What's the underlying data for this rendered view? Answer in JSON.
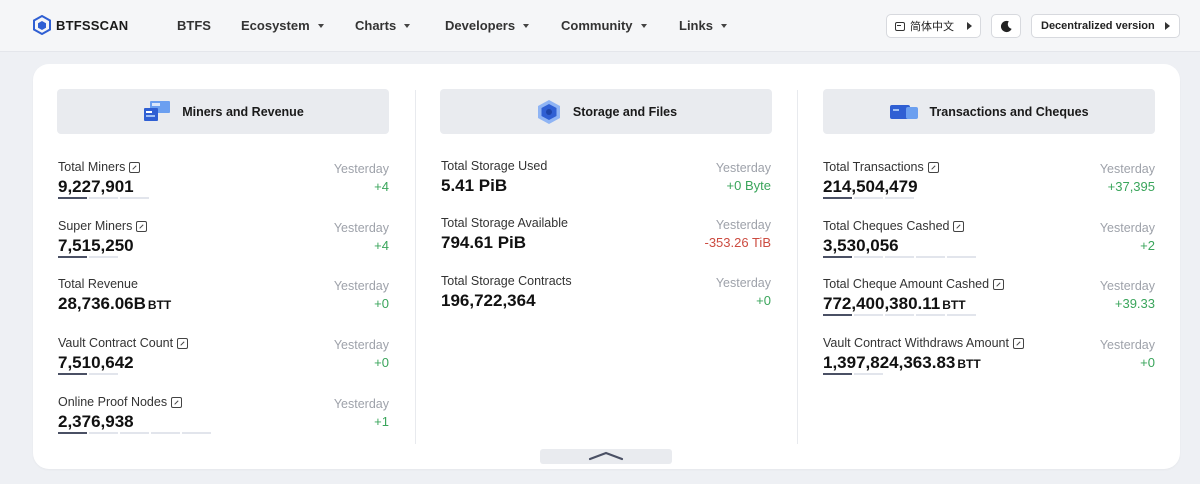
{
  "header": {
    "brand": "BTFSSCAN",
    "nav": [
      {
        "label": "BTFS",
        "dropdown": false
      },
      {
        "label": "Ecosystem",
        "dropdown": true
      },
      {
        "label": "Charts",
        "dropdown": true
      },
      {
        "label": "Developers",
        "dropdown": true
      },
      {
        "label": "Community",
        "dropdown": true
      },
      {
        "label": "Links",
        "dropdown": true
      }
    ],
    "language": "简体中文",
    "decentralized": "Decentralized version"
  },
  "columns": [
    {
      "title": "Miners and Revenue",
      "icon": "miners-icon",
      "stats": [
        {
          "label": "Total Miners",
          "value": "9,227,901",
          "unit": "",
          "yesterday": "Yesterday",
          "delta": "+4",
          "trend": "positive",
          "info": true
        },
        {
          "label": "Super Miners",
          "value": "7,515,250",
          "unit": "",
          "yesterday": "Yesterday",
          "delta": "+4",
          "trend": "positive",
          "info": true
        },
        {
          "label": "Total Revenue",
          "value": "28,736.06B",
          "unit": "BTT",
          "yesterday": "Yesterday",
          "delta": "+0",
          "trend": "positive",
          "info": false
        },
        {
          "label": "Vault Contract Count",
          "value": "7,510,642",
          "unit": "",
          "yesterday": "Yesterday",
          "delta": "+0",
          "trend": "positive",
          "info": true
        },
        {
          "label": "Online Proof Nodes",
          "value": "2,376,938",
          "unit": "",
          "yesterday": "Yesterday",
          "delta": "+1",
          "trend": "positive",
          "info": true
        }
      ]
    },
    {
      "title": "Storage and Files",
      "icon": "storage-icon",
      "stats": [
        {
          "label": "Total Storage Used",
          "value": "5.41 PiB",
          "unit": "",
          "yesterday": "Yesterday",
          "delta": "+0 Byte",
          "trend": "positive",
          "info": false
        },
        {
          "label": "Total Storage Available",
          "value": "794.61 PiB",
          "unit": "",
          "yesterday": "Yesterday",
          "delta": "-353.26 TiB",
          "trend": "negative",
          "info": false
        },
        {
          "label": "Total Storage Contracts",
          "value": "196,722,364",
          "unit": "",
          "yesterday": "Yesterday",
          "delta": "+0",
          "trend": "positive",
          "info": false
        }
      ]
    },
    {
      "title": "Transactions and Cheques",
      "icon": "transactions-icon",
      "stats": [
        {
          "label": "Total Transactions",
          "value": "214,504,479",
          "unit": "",
          "yesterday": "Yesterday",
          "delta": "+37,395",
          "trend": "positive",
          "info": true
        },
        {
          "label": "Total Cheques Cashed",
          "value": "3,530,056",
          "unit": "",
          "yesterday": "Yesterday",
          "delta": "+2",
          "trend": "positive",
          "info": true
        },
        {
          "label": "Total Cheque Amount Cashed",
          "value": "772,400,380.11",
          "unit": "BTT",
          "yesterday": "Yesterday",
          "delta": "+39.33",
          "trend": "positive",
          "info": true
        },
        {
          "label": "Vault Contract Withdraws Amount",
          "value": "1,397,824,363.83",
          "unit": "BTT",
          "yesterday": "Yesterday",
          "delta": "+0",
          "trend": "positive",
          "info": true
        }
      ]
    }
  ],
  "colors": {
    "accent": "#3a6bd8",
    "positive": "#3aa55b",
    "negative": "#cc4b40"
  }
}
